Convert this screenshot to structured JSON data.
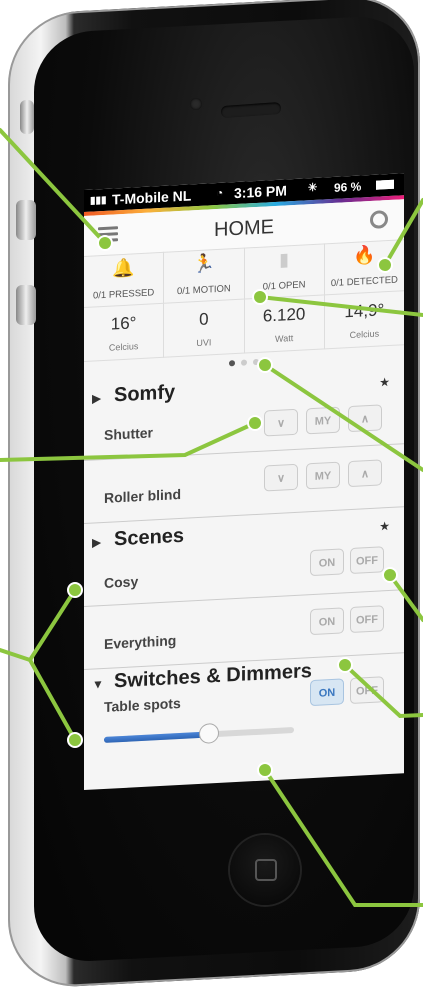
{
  "status_bar": {
    "carrier": "T-Mobile NL",
    "time": "3:16 PM",
    "battery": "96 %"
  },
  "nav": {
    "title": "HOME",
    "menu_icon": "menu-icon",
    "settings_icon": "gear-icon"
  },
  "sensors": [
    {
      "icon": "bell-icon",
      "label": "0/1 PRESSED",
      "value": "16°",
      "unit": "Celcius"
    },
    {
      "icon": "running-man-icon",
      "label": "0/1 MOTION",
      "value": "0",
      "unit": "UVI"
    },
    {
      "icon": "door-icon",
      "label": "0/1 OPEN",
      "value": "6.120",
      "unit": "Watt"
    },
    {
      "icon": "flame-icon",
      "label": "0/1 DETECTED",
      "value": "14,9°",
      "unit": "Celcius"
    }
  ],
  "pager": {
    "pages": 3,
    "active": 1
  },
  "somfy": {
    "title": "Somfy",
    "star": "★",
    "items": [
      {
        "label": "Shutter",
        "buttons": [
          "∨",
          "MY",
          "∧"
        ]
      },
      {
        "label": "Roller blind",
        "buttons": [
          "∨",
          "MY",
          "∧"
        ]
      }
    ]
  },
  "scenes": {
    "title": "Scenes",
    "star": "★",
    "items": [
      {
        "label": "Cosy",
        "on": "ON",
        "off": "OFF"
      },
      {
        "label": "Everything",
        "on": "ON",
        "off": "OFF"
      }
    ]
  },
  "switches": {
    "title": "Switches & Dimmers",
    "items": [
      {
        "label": "Table spots",
        "on": "ON",
        "off": "OFF",
        "on_active": true,
        "dimmer_level": 0.55
      }
    ]
  },
  "colors": {
    "callout": "#8cc63f",
    "accent": "#3b78c0"
  }
}
